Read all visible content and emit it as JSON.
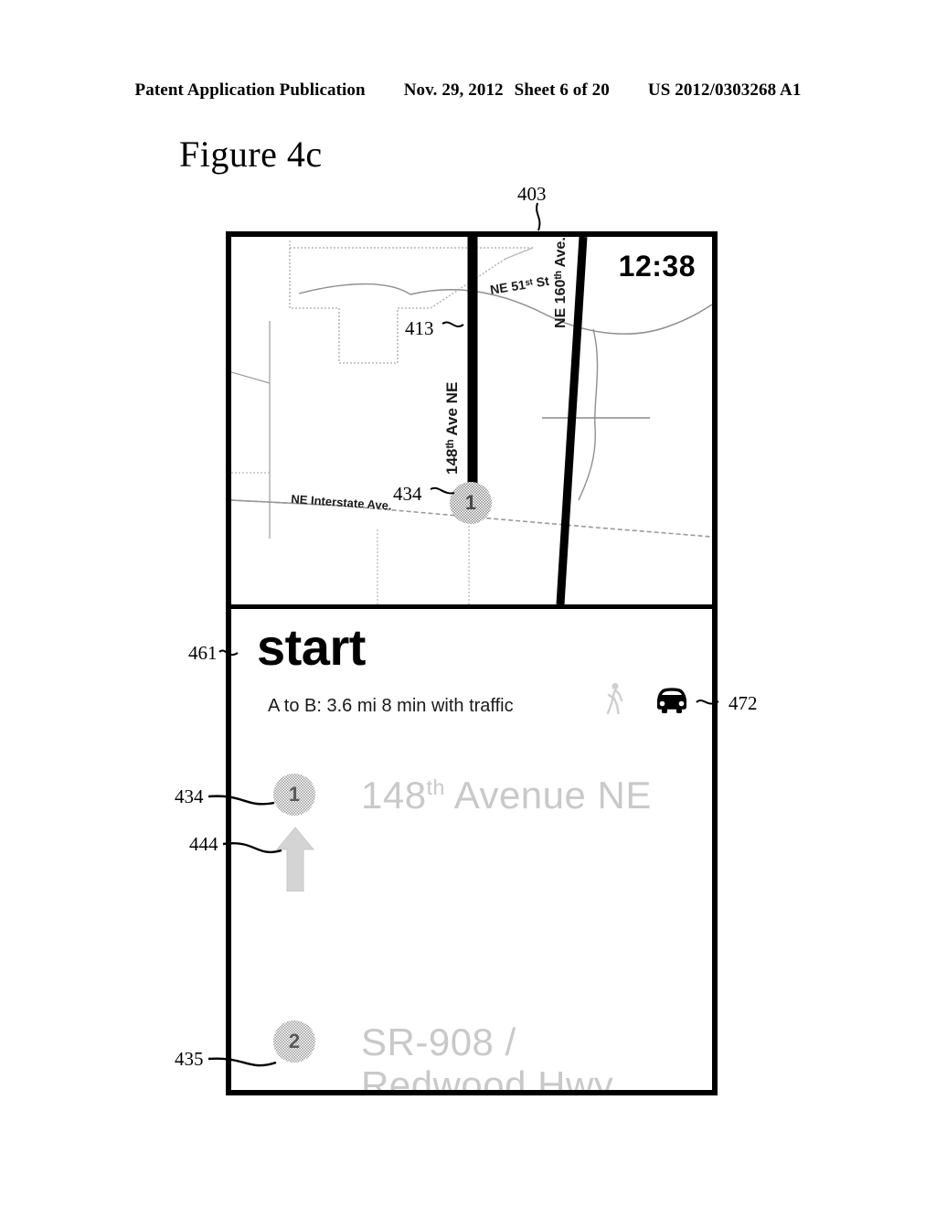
{
  "page_header": {
    "publication": "Patent Application Publication",
    "date": "Nov. 29, 2012",
    "sheet": "Sheet 6 of 20",
    "patent_number": "US 2012/0303268 A1"
  },
  "figure": {
    "title": "Figure 4c"
  },
  "device": {
    "map": {
      "clock": "12:38",
      "street_labels": {
        "cross_street": "NE 51ˢᵗ St",
        "main_avenue_vertical": "148ᵗʰ Ave NE",
        "secondary_avenue_vertical": "NE 160ᵗʰ Ave.",
        "interstate": "NE Interstate Ave."
      },
      "marker_label": "1"
    },
    "directions": {
      "heading": "start",
      "summary": "A to B: 3.6 mi 8 min with traffic",
      "modes": [
        {
          "icon": "walking-icon",
          "selected": false
        },
        {
          "icon": "car-icon",
          "selected": true
        }
      ],
      "steps": [
        {
          "badge": "1",
          "text_main": "148",
          "text_sup": "th",
          "text_rest": " Avenue NE"
        },
        {
          "badge": "2",
          "text_main": "SR-908 /",
          "text_sup": "",
          "text_rest": " Redwood Hwy"
        }
      ]
    }
  },
  "reference_numerals": {
    "device": "403",
    "route_line": "413",
    "map_marker": "434",
    "directions_panel": "461",
    "mode_selector": "472",
    "step_1_badge": "434",
    "step_1_arrow": "444",
    "step_2_badge": "435"
  },
  "colors": {
    "stroke": "#000000",
    "route": "#000000",
    "faded_text": "#c9c9c9",
    "map_road": "#8a8a8a"
  }
}
